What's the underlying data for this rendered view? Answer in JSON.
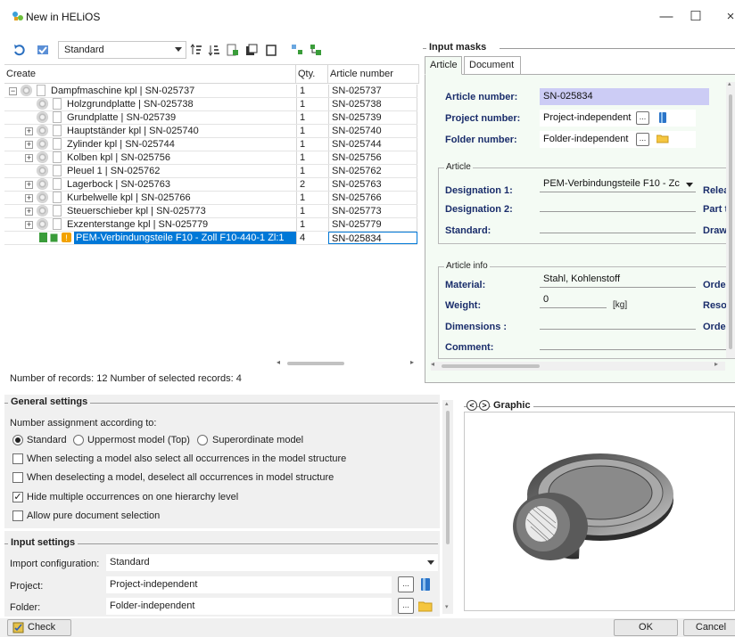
{
  "window": {
    "title": "New in HELiOS",
    "minimize": "—",
    "maximize": "☐",
    "close": "×"
  },
  "toolbar": {
    "model_select": "Standard",
    "icons": [
      "refresh-icon",
      "apply-icon",
      "sort-up-icon",
      "sort-down-icon",
      "add-document-icon",
      "copy-icon",
      "paste-icon",
      "expand-icon",
      "collapse-icon"
    ]
  },
  "tree": {
    "columns": [
      "Create",
      "Qty.",
      "Article number"
    ],
    "rows": [
      {
        "name": "Dampfmaschine kpl | SN-025737",
        "qty": "1",
        "article": "SN-025737",
        "level": 0,
        "expander": "−"
      },
      {
        "name": "Holzgrundplatte | SN-025738",
        "qty": "1",
        "article": "SN-025738",
        "level": 1,
        "expander": ""
      },
      {
        "name": "Grundplatte | SN-025739",
        "qty": "1",
        "article": "SN-025739",
        "level": 1,
        "expander": ""
      },
      {
        "name": "Hauptständer kpl | SN-025740",
        "qty": "1",
        "article": "SN-025740",
        "level": 1,
        "expander": "+"
      },
      {
        "name": "Zylinder kpl | SN-025744",
        "qty": "1",
        "article": "SN-025744",
        "level": 1,
        "expander": "+"
      },
      {
        "name": "Kolben kpl | SN-025756",
        "qty": "1",
        "article": "SN-025756",
        "level": 1,
        "expander": "+"
      },
      {
        "name": "Pleuel 1 | SN-025762",
        "qty": "1",
        "article": "SN-025762",
        "level": 1,
        "expander": ""
      },
      {
        "name": "Lagerbock | SN-025763",
        "qty": "2",
        "article": "SN-025763",
        "level": 1,
        "expander": "+"
      },
      {
        "name": "Kurbelwelle kpl | SN-025766",
        "qty": "1",
        "article": "SN-025766",
        "level": 1,
        "expander": "+"
      },
      {
        "name": "Steuerschieber kpl | SN-025773",
        "qty": "1",
        "article": "SN-025773",
        "level": 1,
        "expander": "+"
      },
      {
        "name": "Exzenterstange kpl | SN-025779",
        "qty": "1",
        "article": "SN-025779",
        "level": 1,
        "expander": "+"
      },
      {
        "name": "PEM-Verbindungsteile F10 - Zoll F10-440-1 Zl:1",
        "qty": "4",
        "article": "SN-025834",
        "level": 1,
        "expander": "",
        "selected": true
      }
    ],
    "records_text": "Number of records: 12  Number of selected records: 4"
  },
  "input_masks": {
    "header": "Input masks",
    "tabs": [
      "Article",
      "Document"
    ],
    "article_number_label": "Article number:",
    "article_number_value": "SN-025834",
    "project_number_label": "Project number:",
    "project_number_value": "Project-independent",
    "folder_number_label": "Folder number:",
    "folder_number_value": "Folder-independent",
    "article_group": "Article",
    "designation1_label": "Designation 1:",
    "designation1_value": "PEM-Verbindungsteile F10 - Zc",
    "designation2_label": "Designation 2:",
    "designation2_value": "",
    "standard_label": "Standard:",
    "standard_value": "",
    "right_label_1": "Relea",
    "right_label_2": "Part t",
    "right_label_3": "Draw",
    "article_info_group": "Article info",
    "material_label": "Material:",
    "material_value": "Stahl, Kohlenstoff",
    "weight_label": "Weight:",
    "weight_value": "0",
    "weight_unit": "[kg]",
    "dimensions_label": "Dimensions :",
    "dimensions_value": "",
    "comment_label": "Comment:",
    "comment_value": "",
    "right_label_4": "Orde",
    "right_label_5": "Reso",
    "right_label_6": "Orde"
  },
  "general_settings": {
    "header": "General settings",
    "number_assignment_label": "Number assignment according to:",
    "radio_standard": "Standard",
    "radio_uppermost": "Uppermost model (Top)",
    "radio_superordinate": "Superordinate model",
    "selected_radio": "Standard",
    "check1": "When selecting a model also select all occurrences in the model structure",
    "check2": "When deselecting a model, deselect all occurrences in model structure",
    "check3": "Hide multiple occurrences on one hierarchy level",
    "check4": "Allow pure document selection",
    "check_mark": "✓"
  },
  "input_settings": {
    "header": "Input settings",
    "import_config_label": "Import configuration:",
    "import_config_value": "Standard",
    "project_label": "Project:",
    "project_value": "Project-independent",
    "folder_label": "Folder:",
    "folder_value": "Folder-independent"
  },
  "graphic": {
    "header": "Graphic",
    "prev": "<",
    "next": ">"
  },
  "buttons": {
    "check": "Check",
    "ok": "OK",
    "cancel": "Cancel"
  }
}
